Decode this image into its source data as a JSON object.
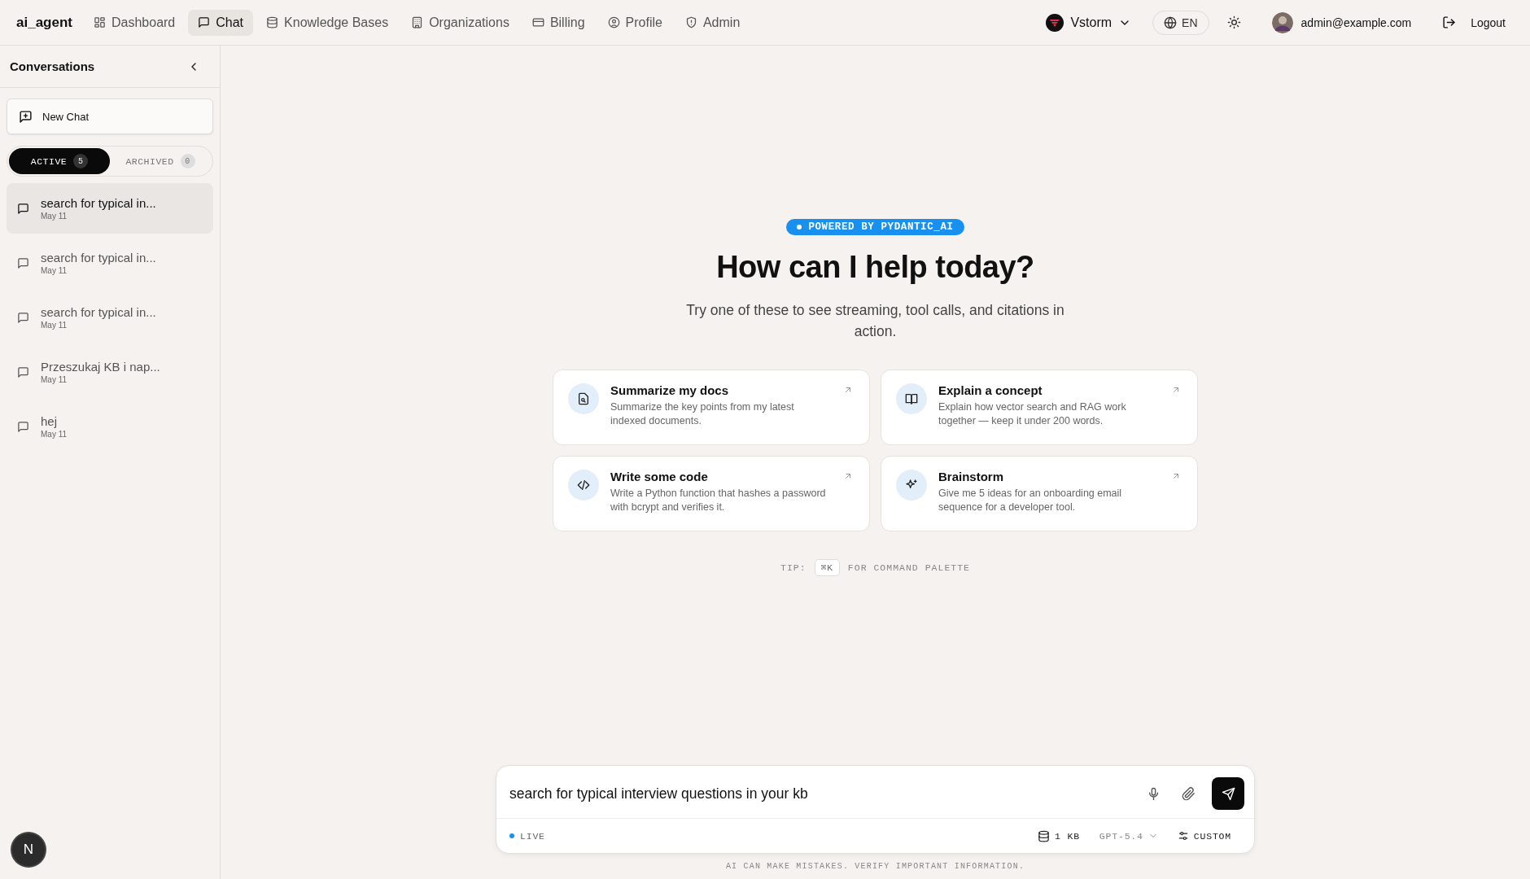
{
  "brand": "ai_agent",
  "nav": [
    {
      "label": "Dashboard",
      "selected": false
    },
    {
      "label": "Chat",
      "selected": true
    },
    {
      "label": "Knowledge Bases",
      "selected": false
    },
    {
      "label": "Organizations",
      "selected": false
    },
    {
      "label": "Billing",
      "selected": false
    },
    {
      "label": "Profile",
      "selected": false
    },
    {
      "label": "Admin",
      "selected": false
    }
  ],
  "org": {
    "name": "Vstorm"
  },
  "language": "EN",
  "user": {
    "email": "admin@example.com"
  },
  "logout": "Logout",
  "sidebar": {
    "title": "Conversations",
    "new_chat": "New Chat",
    "filters": [
      {
        "label": "ACTIVE",
        "count": "5",
        "selected": true
      },
      {
        "label": "ARCHIVED",
        "count": "0",
        "selected": false
      }
    ],
    "conversations": [
      {
        "title": "search for typical in...",
        "date": "May 11",
        "selected": true
      },
      {
        "title": "search for typical in...",
        "date": "May 11",
        "selected": false
      },
      {
        "title": "search for typical in...",
        "date": "May 11",
        "selected": false
      },
      {
        "title": "Przeszukaj KB i nap...",
        "date": "May 11",
        "selected": false
      },
      {
        "title": "hej",
        "date": "May 11",
        "selected": false
      }
    ]
  },
  "badge": "POWERED BY PYDANTIC_AI",
  "heading": "How can I help today?",
  "subheading": "Try one of these to see streaming, tool calls, and citations in action.",
  "suggestions": [
    {
      "title": "Summarize my docs",
      "description": "Summarize the key points from my latest indexed documents."
    },
    {
      "title": "Explain a concept",
      "description": "Explain how vector search and RAG work together — keep it under 200 words."
    },
    {
      "title": "Write some code",
      "description": "Write a Python function that hashes a password with bcrypt and verifies it."
    },
    {
      "title": "Brainstorm",
      "description": "Give me 5 ideas for an onboarding email sequence for a developer tool."
    }
  ],
  "tip": {
    "prefix": "TIP:",
    "key": "⌘K",
    "suffix": "FOR COMMAND PALETTE"
  },
  "composer": {
    "value": "search for typical interview questions in your kb",
    "status": "LIVE",
    "kb": "1 KB",
    "model": "GPT-5.4",
    "mode": "CUSTOM"
  },
  "disclaimer": "AI CAN MAKE MISTAKES. VERIFY IMPORTANT INFORMATION.",
  "avatar": {
    "letter": "N"
  }
}
